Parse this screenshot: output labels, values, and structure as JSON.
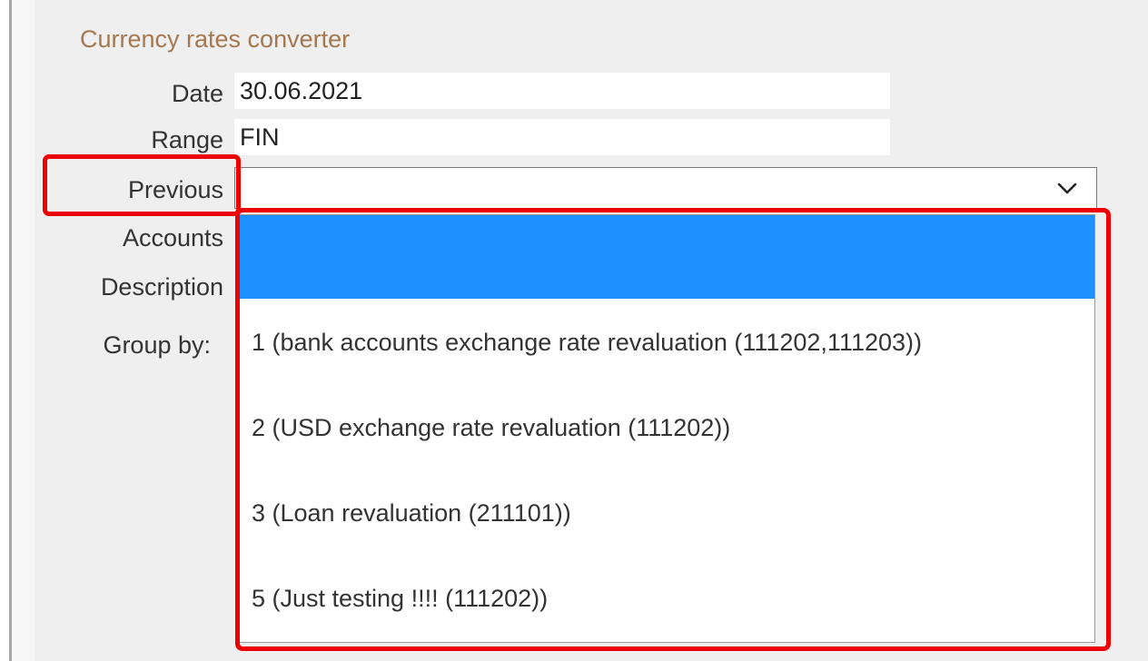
{
  "form": {
    "title": "Currency rates converter",
    "date": {
      "label": "Date",
      "value": "30.06.2021"
    },
    "range": {
      "label": "Range",
      "value": "FIN"
    },
    "previous": {
      "label": "Previous",
      "value": ""
    },
    "accounts": {
      "label": "Accounts"
    },
    "description": {
      "label": "Description"
    },
    "group_by": {
      "label": "Group by:"
    }
  },
  "dropdown": {
    "options": [
      {
        "label": "",
        "selected": true
      },
      {
        "label": "1 (bank accounts exchange rate revaluation (111202,111203))",
        "selected": false
      },
      {
        "label": "2 (USD exchange rate revaluation (111202))",
        "selected": false
      },
      {
        "label": "3 (Loan revaluation (211101))",
        "selected": false
      },
      {
        "label": "5 (Just testing !!!! (111202))",
        "selected": false
      }
    ]
  },
  "icons": {
    "select_arrow": "chevron-down-icon"
  },
  "colors": {
    "title": "#a5784f",
    "selected_option": "#1e90ff",
    "highlight": "#ee0000",
    "panel_background": "#efefef"
  }
}
